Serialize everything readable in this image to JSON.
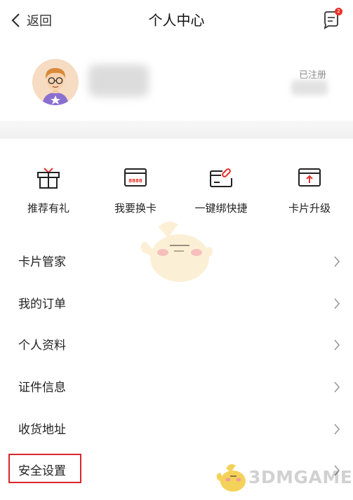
{
  "header": {
    "back_label": "返回",
    "title": "个人中心",
    "message_badge": "2"
  },
  "profile": {
    "status_label": "已注册"
  },
  "quick_actions": [
    {
      "label": "推荐有礼",
      "icon": "gift-icon"
    },
    {
      "label": "我要换卡",
      "icon": "card-change-icon",
      "card_text": "8888"
    },
    {
      "label": "一键绑快捷",
      "icon": "card-link-icon"
    },
    {
      "label": "卡片升级",
      "icon": "card-upgrade-icon"
    }
  ],
  "menu": [
    {
      "label": "卡片管家"
    },
    {
      "label": "我的订单"
    },
    {
      "label": "个人资料"
    },
    {
      "label": "证件信息"
    },
    {
      "label": "收货地址"
    },
    {
      "label": "安全设置",
      "highlighted": true
    }
  ],
  "watermark": {
    "text": "3DMGAME"
  },
  "colors": {
    "accent": "#e8322b",
    "highlight_border": "#d9262b"
  }
}
